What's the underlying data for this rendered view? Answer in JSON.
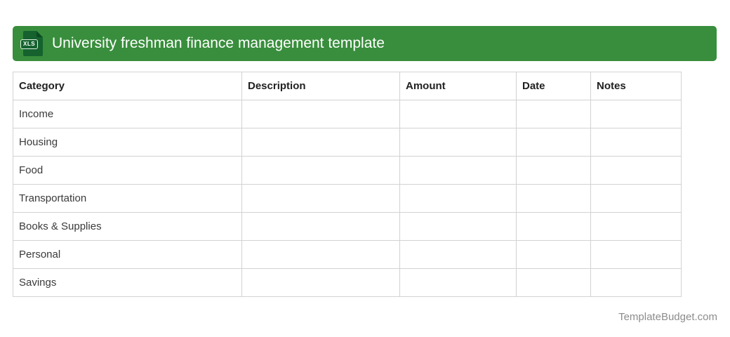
{
  "header": {
    "title": "University freshman finance management template",
    "icon_label": "XLS",
    "bar_color": "#388E3C",
    "icon_color": "#15622F",
    "title_color": "#FFFFFF"
  },
  "table": {
    "border_color": "#D2D2D2",
    "columns": [
      "Category",
      "Description",
      "Amount",
      "Date",
      "Notes"
    ],
    "rows": [
      {
        "cells": [
          "Income",
          "",
          "",
          "",
          ""
        ]
      },
      {
        "cells": [
          "Housing",
          "",
          "",
          "",
          ""
        ]
      },
      {
        "cells": [
          "Food",
          "",
          "",
          "",
          ""
        ]
      },
      {
        "cells": [
          "Transportation",
          "",
          "",
          "",
          ""
        ]
      },
      {
        "cells": [
          "Books & Supplies",
          "",
          "",
          "",
          ""
        ]
      },
      {
        "cells": [
          "Personal",
          "",
          "",
          "",
          ""
        ]
      },
      {
        "cells": [
          "Savings",
          "",
          "",
          "",
          ""
        ]
      }
    ]
  },
  "footer": {
    "credit": "TemplateBudget.com",
    "color": "#8C8C8C"
  }
}
